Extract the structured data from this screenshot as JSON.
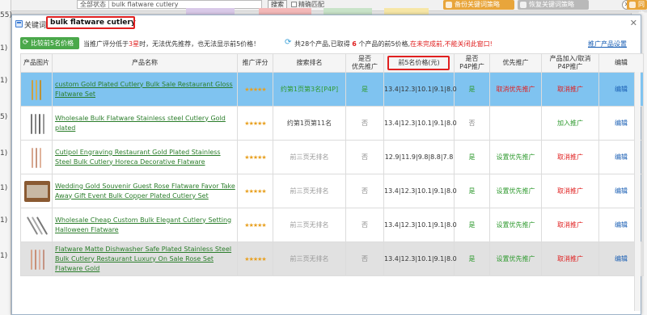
{
  "background": {
    "status_select": "全部状态",
    "search_input_value": "bulk flatware cutlery",
    "search_button": "搜索",
    "exact_match_label": "精确匹配",
    "backup_button": "备份关键词策略",
    "restore_button": "恢复关键词策略",
    "sync_button": "同步",
    "left_numbers": [
      "55)",
      "1)",
      "1)",
      "5)",
      "1)",
      "1)",
      "1)",
      "1)"
    ]
  },
  "dialog": {
    "keyword_label": "关键词:",
    "keyword_value": "bulk flatware cutlery",
    "close_symbol": "✕",
    "compare_button": "比较前5名价格",
    "info_part1": "当推广评分低于",
    "info_stars": "3星",
    "info_part2": "时，无法优先推荐，也无法显示前5价格！",
    "total_prefix": "共28个产品,已取得",
    "total_count": "6",
    "total_suffix": "个产品的前5价格,",
    "total_warning": "在未完成前,不能关闭此窗口!",
    "settings_link": "推广产品设置",
    "columns": [
      "产品图片",
      "产品名称",
      "推广评分",
      "搜索排名",
      "是否\n优先推广",
      "前5名价格(元)",
      "是否\nP4P推广",
      "优先推广",
      "产品加入/取消\nP4P推广",
      "编辑"
    ],
    "rows": [
      {
        "name": "custom Gold Plated Cutlery Bulk Sale Restaurant Gloss Flatware Set",
        "stars": "★★★★",
        "rank": "约第1页第3名[P4P]",
        "priority": "是",
        "top5": "13.4|12.3|10.1|9.1|8.0",
        "p4p": "是",
        "priority_action": "取消优先推广",
        "p4p_action": "取消推广",
        "edit": "编辑"
      },
      {
        "name": "Wholesale Bulk Flatware Stainless steel Cutlery Gold plated",
        "stars": "★★★★",
        "rank": "约第1页第11名",
        "priority": "否",
        "top5": "13.4|12.3|10.1|9.1|8.0",
        "p4p": "否",
        "priority_action": "",
        "p4p_action": "加入推广",
        "edit": "编辑"
      },
      {
        "name": "Cutipol Engraving Restaurant Gold Plated Stainless Steel Bulk Cutlery Horeca Decorative Flatware",
        "stars": "★★★★",
        "rank": "前三页无排名",
        "priority": "否",
        "top5": "12.9|11.9|9.8|8.8|7.8",
        "p4p": "是",
        "priority_action": "设置优先推广",
        "p4p_action": "取消推广",
        "edit": "编辑"
      },
      {
        "name": "Wedding Gold Souvenir Guest Rose Flatware Favor Take Away Gift Event Bulk Copper Plated Cutlery Set",
        "stars": "★★★★",
        "rank": "前三页无排名",
        "priority": "否",
        "top5": "13.4|12.3|10.1|9.1|8.0",
        "p4p": "是",
        "priority_action": "设置优先推广",
        "p4p_action": "取消推广",
        "edit": "编辑"
      },
      {
        "name": "Wholesale Cheap Custom Bulk Elegant Cutlery Setting Halloween Flatware",
        "stars": "★★★★",
        "rank": "前三页无排名",
        "priority": "否",
        "top5": "13.4|12.3|10.1|9.1|8.0",
        "p4p": "是",
        "priority_action": "设置优先推广",
        "p4p_action": "取消推广",
        "edit": "编辑"
      },
      {
        "name": "Flatware Matte Dishwasher Safe Plated Stainless Steel Bulk Cutlery Restaurant Luxury On Sale Rose Set Flatware Gold",
        "stars": "★★★★",
        "rank": "前三页无排名",
        "priority": "否",
        "top5": "13.4|12.3|10.1|9.1|8.0",
        "p4p": "是",
        "priority_action": "设置优先推广",
        "p4p_action": "取消推广",
        "edit": "编辑"
      }
    ]
  },
  "colors": {
    "highlight_row": "#7fc3f0",
    "gray_row": "#e1e1e1",
    "red": "#e02020",
    "green": "#2f9a2f",
    "link_blue": "#1a5fb4"
  }
}
